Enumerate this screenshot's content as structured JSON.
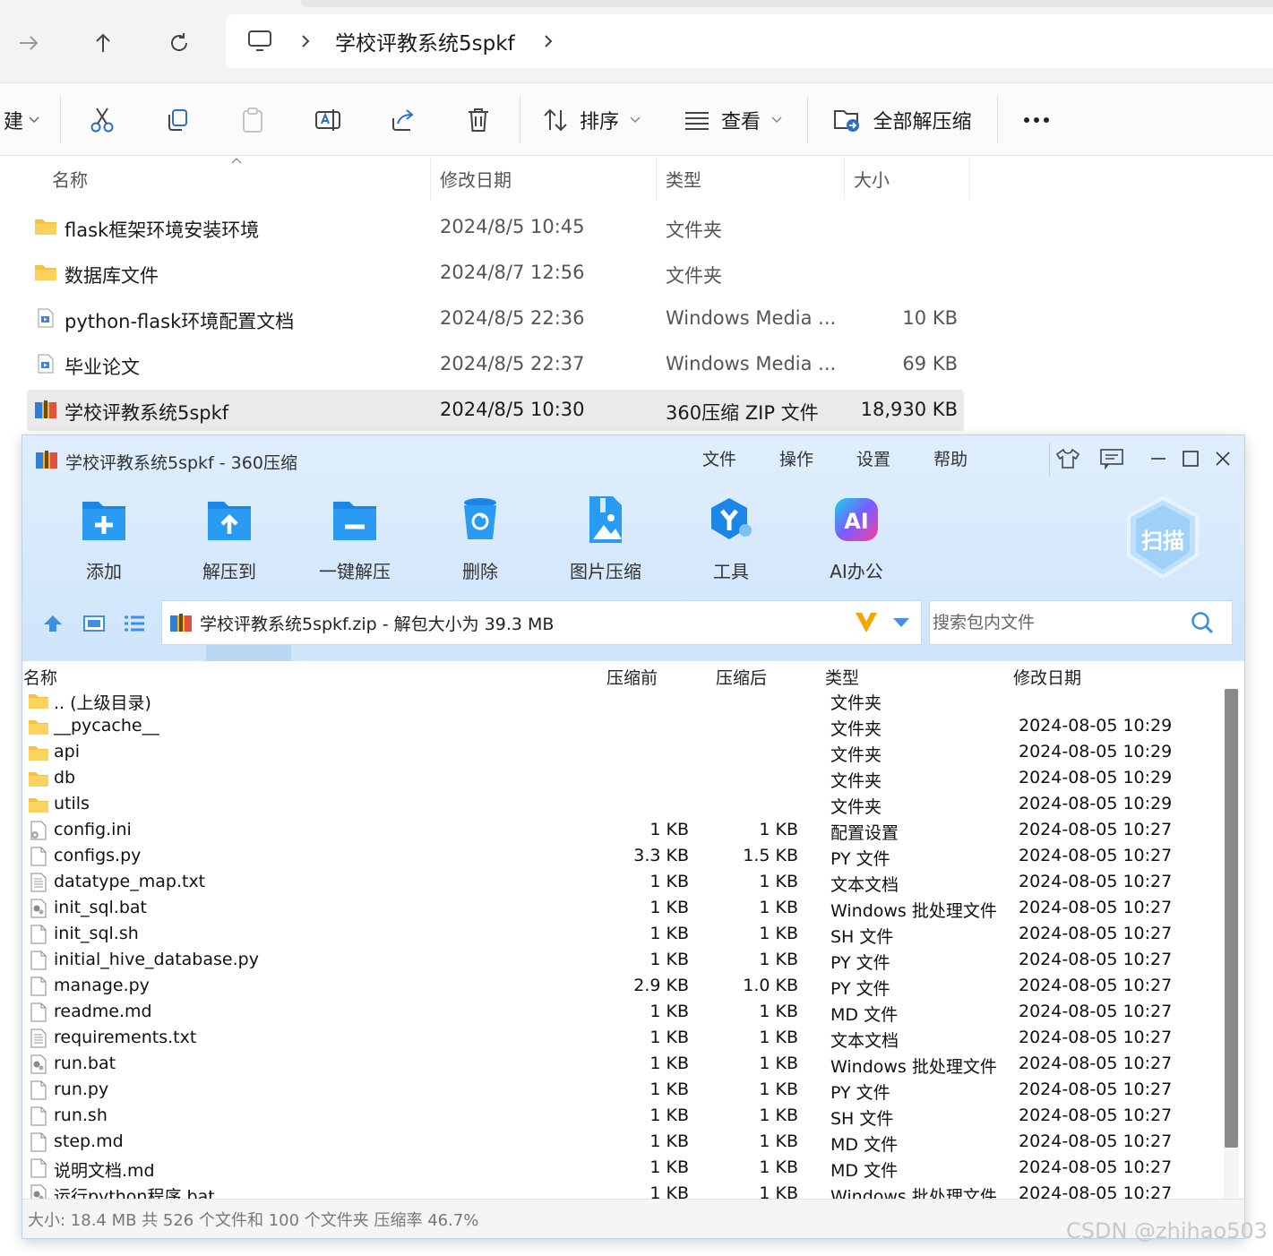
{
  "explorer": {
    "breadcrumb": "学校评教系统5spkf",
    "toolbar": {
      "new_label": "建",
      "sort_label": "排序",
      "view_label": "查看",
      "extract_all_label": "全部解压缩"
    },
    "columns": {
      "name": "名称",
      "date": "修改日期",
      "type": "类型",
      "size": "大小"
    },
    "files": [
      {
        "name": "flask框架环境安装环境",
        "date": "2024/8/5 10:45",
        "type": "文件夹",
        "size": "",
        "kind": "folder"
      },
      {
        "name": "数据库文件",
        "date": "2024/8/7 12:56",
        "type": "文件夹",
        "size": "",
        "kind": "folder"
      },
      {
        "name": "python-flask环境配置文档",
        "date": "2024/8/5 22:36",
        "type": "Windows Media ...",
        "size": "10 KB",
        "kind": "media"
      },
      {
        "name": "毕业论文",
        "date": "2024/8/5 22:37",
        "type": "Windows Media ...",
        "size": "69 KB",
        "kind": "media"
      },
      {
        "name": "学校评教系统5spkf",
        "date": "2024/8/5 10:30",
        "type": "360压缩 ZIP 文件",
        "size": "18,930 KB",
        "kind": "zip"
      }
    ]
  },
  "zipwin": {
    "title": "学校评教系统5spkf - 360压缩",
    "menu": [
      "文件",
      "操作",
      "设置",
      "帮助"
    ],
    "actions": [
      {
        "label": "添加",
        "icon": "add-icon"
      },
      {
        "label": "解压到",
        "icon": "extract-to-icon"
      },
      {
        "label": "一键解压",
        "icon": "one-click-extract-icon"
      },
      {
        "label": "删除",
        "icon": "delete-icon"
      },
      {
        "label": "图片压缩",
        "icon": "image-compress-icon"
      },
      {
        "label": "工具",
        "icon": "tools-icon"
      },
      {
        "label": "AI办公",
        "icon": "ai-office-icon"
      }
    ],
    "scan_label": "扫描",
    "path": "学校评教系统5spkf.zip - 解包大小为 39.3 MB",
    "search_placeholder": "搜索包内文件",
    "columns": {
      "name": "名称",
      "before": "压缩前",
      "after": "压缩后",
      "type": "类型",
      "date": "修改日期"
    },
    "rows": [
      {
        "name": ".. (上级目录)",
        "before": "",
        "after": "",
        "type": "文件夹",
        "date": "",
        "kind": "folder"
      },
      {
        "name": "__pycache__",
        "before": "",
        "after": "",
        "type": "文件夹",
        "date": "2024-08-05 10:29",
        "kind": "folder"
      },
      {
        "name": "api",
        "before": "",
        "after": "",
        "type": "文件夹",
        "date": "2024-08-05 10:29",
        "kind": "folder"
      },
      {
        "name": "db",
        "before": "",
        "after": "",
        "type": "文件夹",
        "date": "2024-08-05 10:29",
        "kind": "folder"
      },
      {
        "name": "utils",
        "before": "",
        "after": "",
        "type": "文件夹",
        "date": "2024-08-05 10:29",
        "kind": "folder"
      },
      {
        "name": "config.ini",
        "before": "1 KB",
        "after": "1 KB",
        "type": "配置设置",
        "date": "2024-08-05 10:27",
        "kind": "ini"
      },
      {
        "name": "configs.py",
        "before": "3.3 KB",
        "after": "1.5 KB",
        "type": "PY 文件",
        "date": "2024-08-05 10:27",
        "kind": "file"
      },
      {
        "name": "datatype_map.txt",
        "before": "1 KB",
        "after": "1 KB",
        "type": "文本文档",
        "date": "2024-08-05 10:27",
        "kind": "txt"
      },
      {
        "name": "init_sql.bat",
        "before": "1 KB",
        "after": "1 KB",
        "type": "Windows 批处理文件",
        "date": "2024-08-05 10:27",
        "kind": "bat"
      },
      {
        "name": "init_sql.sh",
        "before": "1 KB",
        "after": "1 KB",
        "type": "SH 文件",
        "date": "2024-08-05 10:27",
        "kind": "file"
      },
      {
        "name": "initial_hive_database.py",
        "before": "1 KB",
        "after": "1 KB",
        "type": "PY 文件",
        "date": "2024-08-05 10:27",
        "kind": "file"
      },
      {
        "name": "manage.py",
        "before": "2.9 KB",
        "after": "1.0 KB",
        "type": "PY 文件",
        "date": "2024-08-05 10:27",
        "kind": "file"
      },
      {
        "name": "readme.md",
        "before": "1 KB",
        "after": "1 KB",
        "type": "MD 文件",
        "date": "2024-08-05 10:27",
        "kind": "file"
      },
      {
        "name": "requirements.txt",
        "before": "1 KB",
        "after": "1 KB",
        "type": "文本文档",
        "date": "2024-08-05 10:27",
        "kind": "txt"
      },
      {
        "name": "run.bat",
        "before": "1 KB",
        "after": "1 KB",
        "type": "Windows 批处理文件",
        "date": "2024-08-05 10:27",
        "kind": "bat"
      },
      {
        "name": "run.py",
        "before": "1 KB",
        "after": "1 KB",
        "type": "PY 文件",
        "date": "2024-08-05 10:27",
        "kind": "file"
      },
      {
        "name": "run.sh",
        "before": "1 KB",
        "after": "1 KB",
        "type": "SH 文件",
        "date": "2024-08-05 10:27",
        "kind": "file"
      },
      {
        "name": "step.md",
        "before": "1 KB",
        "after": "1 KB",
        "type": "MD 文件",
        "date": "2024-08-05 10:27",
        "kind": "file"
      },
      {
        "name": "说明文档.md",
        "before": "1 KB",
        "after": "1 KB",
        "type": "MD 文件",
        "date": "2024-08-05 10:27",
        "kind": "file"
      },
      {
        "name": "运行python程序.bat",
        "before": "1 KB",
        "after": "1 KB",
        "type": "Windows 批处理文件",
        "date": "2024-08-05 10:27",
        "kind": "bat"
      }
    ],
    "status": "大小: 18.4 MB 共 526 个文件和 100 个文件夹 压缩率 46.7%"
  },
  "watermark": "CSDN @zhihao503"
}
